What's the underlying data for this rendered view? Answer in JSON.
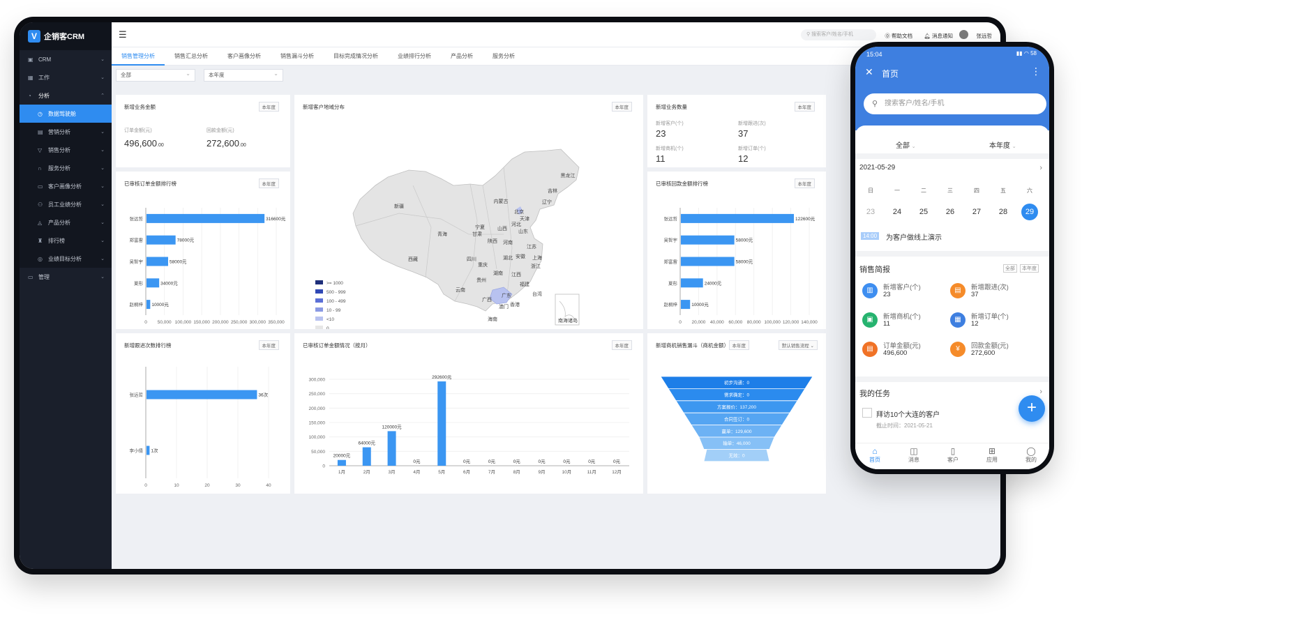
{
  "app": {
    "name": "企销客CRM",
    "logo_glyph": "V"
  },
  "sidebar": {
    "items": [
      {
        "label": "CRM",
        "icon": "box-icon",
        "chev": "⌄"
      },
      {
        "label": "工作",
        "icon": "calendar-icon",
        "chev": "⌄"
      },
      {
        "label": "分析",
        "icon": "pie-icon",
        "chev": "⌃"
      },
      {
        "label": "数据驾驶舱",
        "icon": "dashboard-icon"
      },
      {
        "label": "营销分析",
        "icon": "gift-icon",
        "chev": "⌄"
      },
      {
        "label": "销售分析",
        "icon": "funnel-icon",
        "chev": "⌄"
      },
      {
        "label": "服务分析",
        "icon": "headset-icon",
        "chev": "⌄"
      },
      {
        "label": "客户画像分析",
        "icon": "id-card-icon",
        "chev": "⌄"
      },
      {
        "label": "员工业绩分析",
        "icon": "people-icon",
        "chev": "⌄"
      },
      {
        "label": "产品分析",
        "icon": "product-icon",
        "chev": "⌄"
      },
      {
        "label": "排行榜",
        "icon": "trophy-icon",
        "chev": "⌄"
      },
      {
        "label": "业绩目标分析",
        "icon": "target-icon",
        "chev": "⌄"
      },
      {
        "label": "管理",
        "icon": "monitor-icon",
        "chev": "⌄"
      }
    ]
  },
  "topbar": {
    "search_placeholder": "搜索客户/姓名/手机",
    "help": "帮助文档",
    "notify": "消息通知",
    "user": "张远哲"
  },
  "tabs": [
    "销售管理分析",
    "销售汇总分析",
    "客户画像分析",
    "销售漏斗分析",
    "目标完成情况分析",
    "业绩排行分析",
    "产品分析",
    "服务分析"
  ],
  "filters": {
    "scope": "全部",
    "period": "本年度"
  },
  "tag_year": "本年度",
  "card_new_amount": {
    "title": "新增业务金额",
    "order_label": "订单金额(元)",
    "order_value": "496,600",
    "order_cents": ".00",
    "pay_label": "回款金额(元)",
    "pay_value": "272,600",
    "pay_cents": ".00"
  },
  "card_new_count": {
    "title": "新增业务数量",
    "stats": [
      {
        "label": "新增客户(个)",
        "value": "23"
      },
      {
        "label": "新增跟进(次)",
        "value": "37"
      },
      {
        "label": "新增商机(个)",
        "value": "11"
      },
      {
        "label": "新增订单(个)",
        "value": "12"
      }
    ]
  },
  "card_map": {
    "title": "新增客户地域分布",
    "legend": [
      {
        "label": ">= 1000",
        "color": "#1e2f7a"
      },
      {
        "label": "500 - 999",
        "color": "#3048b5"
      },
      {
        "label": "100 - 499",
        "color": "#5b6fd6"
      },
      {
        "label": "10 - 99",
        "color": "#8a99e3"
      },
      {
        "label": "<10",
        "color": "#b8c2f0"
      },
      {
        "label": "0",
        "color": "#e6e6e6"
      }
    ],
    "provinces": [
      "黑龙江",
      "吉林",
      "辽宁",
      "内蒙古",
      "北京",
      "天津",
      "河北",
      "新疆",
      "宁夏",
      "山西",
      "山东",
      "甘肃",
      "青海",
      "陕西",
      "河南",
      "江苏",
      "西藏",
      "四川",
      "湖北",
      "安徽",
      "上海",
      "重庆",
      "浙江",
      "湖南",
      "江西",
      "贵州",
      "云南",
      "福建",
      "广西",
      "广东",
      "台湾",
      "香港",
      "澳门",
      "海南",
      "南海诸岛"
    ]
  },
  "card_funnel": {
    "title": "新增商机销售漏斗（商机金额）",
    "flow": "默认销售流程",
    "stages": [
      {
        "label": "初步沟通：0",
        "value": 0
      },
      {
        "label": "需求确定：0",
        "value": 0
      },
      {
        "label": "方案报价：137,200",
        "value": 137200
      },
      {
        "label": "合同签订：0",
        "value": 0
      },
      {
        "label": "赢单：129,600",
        "value": 129600
      },
      {
        "label": "输单：46,000",
        "value": 46000
      },
      {
        "label": "无效：0",
        "value": 0
      }
    ]
  },
  "chart_data": [
    {
      "type": "bar",
      "orientation": "horizontal",
      "title": "已审核订单金额排行榜",
      "categories": [
        "张远哲",
        "郑富雷",
        "吴智宇",
        "夏彤",
        "赵桐梓"
      ],
      "values": [
        316600,
        78000,
        58000,
        34000,
        10000
      ],
      "labels": [
        "316600元",
        "78000元",
        "58000元",
        "34000元",
        "10000元"
      ],
      "ticks": [
        "0",
        "50,000",
        "100,000",
        "150,000",
        "200,000",
        "250,000",
        "300,000",
        "350,000"
      ],
      "xlim": [
        0,
        350000
      ]
    },
    {
      "type": "bar",
      "orientation": "horizontal",
      "title": "已审核回款金额排行榜",
      "categories": [
        "张远哲",
        "吴智宇",
        "郑富雷",
        "夏彤",
        "赵桐梓"
      ],
      "values": [
        122600,
        58000,
        58000,
        24000,
        10000
      ],
      "labels": [
        "122600元",
        "58000元",
        "58000元",
        "24000元",
        "10000元"
      ],
      "ticks": [
        "0",
        "20,000",
        "40,000",
        "60,000",
        "80,000",
        "100,000",
        "120,000",
        "140,000"
      ],
      "xlim": [
        0,
        140000
      ]
    },
    {
      "type": "bar",
      "orientation": "horizontal",
      "title": "新增跟进次数排行榜",
      "categories": [
        "张远哲",
        "李小倩"
      ],
      "values": [
        36,
        1
      ],
      "labels": [
        "36次",
        "1次"
      ],
      "ticks": [
        "0",
        "10",
        "20",
        "30",
        "40"
      ],
      "xlim": [
        0,
        40
      ]
    },
    {
      "type": "bar",
      "title": "已审核订单金额情况（按月）",
      "categories": [
        "1月",
        "2月",
        "3月",
        "4月",
        "5月",
        "6月",
        "7月",
        "8月",
        "9月",
        "10月",
        "11月",
        "12月"
      ],
      "values": [
        20000,
        64000,
        120000,
        0,
        292600,
        0,
        0,
        0,
        0,
        0,
        0,
        0
      ],
      "labels": [
        "20000元",
        "64000元",
        "120000元",
        "0元",
        "292600元",
        "0元",
        "0元",
        "0元",
        "0元",
        "0元",
        "0元",
        "0元"
      ],
      "ticks": [
        "0",
        "50,000",
        "100,000",
        "150,000",
        "200,000",
        "250,000",
        "300,000"
      ],
      "ylim": [
        0,
        300000
      ]
    }
  ],
  "phone": {
    "time": "15:04",
    "status_right": "▮▮ ◠ 58",
    "title": "首页",
    "search_placeholder": "搜索客户/姓名/手机",
    "scope": "全部",
    "period": "本年度",
    "date": "2021-05-29",
    "weekdays": [
      "日",
      "一",
      "二",
      "三",
      "四",
      "五",
      "六"
    ],
    "days": [
      "23",
      "24",
      "25",
      "26",
      "27",
      "28",
      "29"
    ],
    "event_time": "14:00",
    "event": "为客户做线上演示",
    "report_title": "销售简报",
    "chip_all": "全部",
    "chip_year": "本年度",
    "stats": [
      {
        "label": "新增客户(个)",
        "value": "23",
        "color": "#3e8ef0"
      },
      {
        "label": "新增跟进(次)",
        "value": "37",
        "color": "#f58b2a"
      },
      {
        "label": "新增商机(个)",
        "value": "11",
        "color": "#26b36f"
      },
      {
        "label": "新增订单(个)",
        "value": "12",
        "color": "#3e7fe0"
      },
      {
        "label": "订单金额(元)",
        "value": "496,600",
        "color": "#f07226"
      },
      {
        "label": "回款金额(元)",
        "value": "272,600",
        "color": "#f58b2a"
      }
    ],
    "tasks_title": "我的任务",
    "task": "拜访10个大连的客户",
    "task_due": "截止时间：2021-05-21",
    "tabbar": [
      {
        "label": "首页",
        "icon": "home-icon"
      },
      {
        "label": "消息",
        "icon": "message-icon"
      },
      {
        "label": "客户",
        "icon": "customer-icon"
      },
      {
        "label": "应用",
        "icon": "apps-icon"
      },
      {
        "label": "我的",
        "icon": "profile-icon"
      }
    ]
  }
}
